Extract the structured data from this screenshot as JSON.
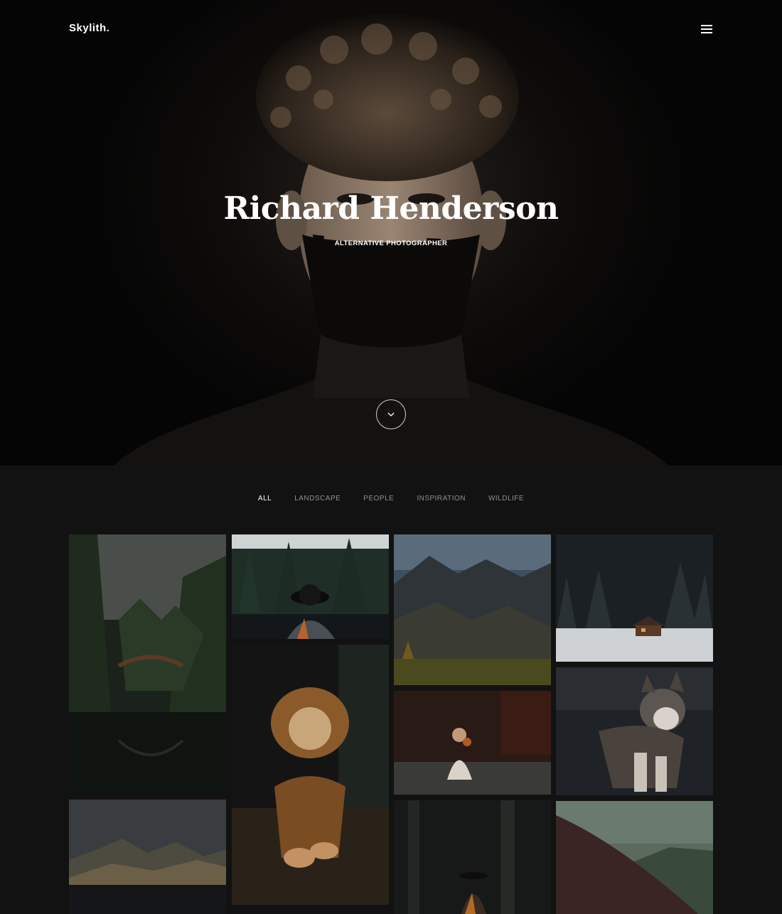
{
  "header": {
    "logo": "Skylith."
  },
  "hero": {
    "title": "Richard Henderson",
    "subtitle": "ALTERNATIVE PHOTOGRAPHER"
  },
  "filters": [
    {
      "label": "ALL",
      "active": true
    },
    {
      "label": "LANDSCAPE",
      "active": false
    },
    {
      "label": "PEOPLE",
      "active": false
    },
    {
      "label": "INSPIRATION",
      "active": false
    },
    {
      "label": "WILDLIFE",
      "active": false
    }
  ],
  "icons": {
    "menu": "hamburger-icon",
    "scroll": "chevron-down-icon"
  },
  "colors": {
    "background": "#121212",
    "hero_background": "#050505",
    "text": "#ffffff",
    "filter_inactive": "#8f8f8f"
  }
}
